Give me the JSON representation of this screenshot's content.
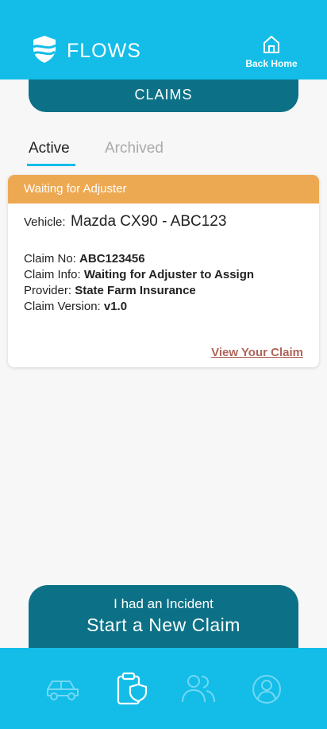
{
  "header": {
    "brand": "FLOWS",
    "back_home_label": "Back Home",
    "color": "#13bde8"
  },
  "section": {
    "title": "CLAIMS"
  },
  "tabs": [
    {
      "label": "Active",
      "selected": true
    },
    {
      "label": "Archived",
      "selected": false
    }
  ],
  "claim": {
    "status": "Waiting for Adjuster",
    "status_color": "#eda952",
    "vehicle_label": "Vehicle:",
    "vehicle_value": "Mazda CX90 - ABC123",
    "claim_no_label": "Claim No:",
    "claim_no_value": "ABC123456",
    "claim_info_label": "Claim Info:",
    "claim_info_value": "Waiting for Adjuster to Assign",
    "provider_label": "Provider:",
    "provider_value": "State Farm Insurance",
    "version_label": "Claim Version:",
    "version_value": "v1.0",
    "view_link": "View Your Claim"
  },
  "start_claim": {
    "pre_label": "I had an Incident",
    "main_label": "Start a New Claim"
  },
  "nav": {
    "items": [
      {
        "icon": "car-icon",
        "active": false
      },
      {
        "icon": "clipboard-shield-icon",
        "active": true
      },
      {
        "icon": "people-icon",
        "active": false
      },
      {
        "icon": "profile-icon",
        "active": false
      }
    ]
  }
}
